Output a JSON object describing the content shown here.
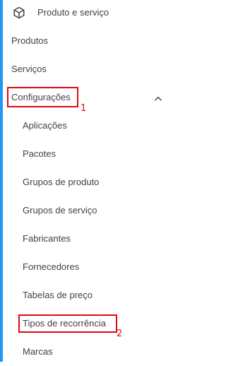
{
  "menu": {
    "header": {
      "icon": "cube-icon",
      "label": "Produto e serviço"
    },
    "items": [
      {
        "label": "Produtos"
      },
      {
        "label": "Serviços"
      },
      {
        "label": "Configurações",
        "expanded": true
      }
    ],
    "subitems": [
      {
        "label": "Aplicações"
      },
      {
        "label": "Pacotes"
      },
      {
        "label": "Grupos de produto"
      },
      {
        "label": "Grupos de serviço"
      },
      {
        "label": "Fabricantes"
      },
      {
        "label": "Fornecedores"
      },
      {
        "label": "Tabelas de preço"
      },
      {
        "label": "Tipos de recorrência"
      },
      {
        "label": "Marcas"
      }
    ]
  },
  "annotations": [
    {
      "number": "1"
    },
    {
      "number": "2"
    }
  ],
  "colors": {
    "accent": "#2196f3",
    "text": "#424242",
    "highlight": "#e30613"
  }
}
